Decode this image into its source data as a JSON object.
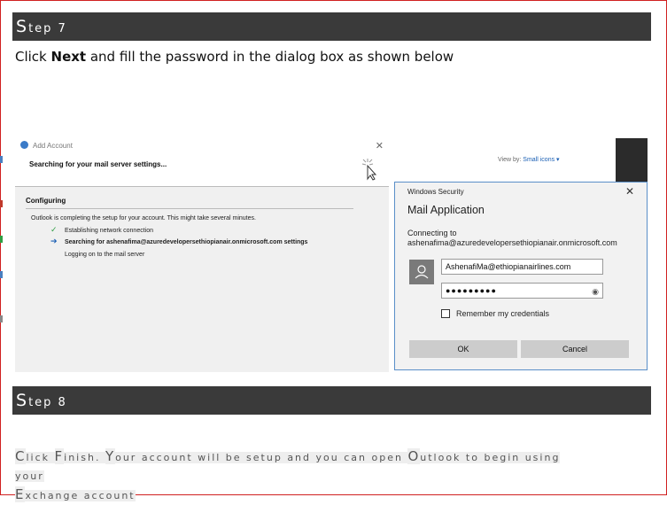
{
  "step7": {
    "first": "S",
    "rest": "tep 7"
  },
  "instruction": {
    "pre": "Click ",
    "bold": "Next",
    "post": " and fill the password in the dialog box as shown below"
  },
  "wizard": {
    "title": "Add Account",
    "subtitle": "Searching for your mail server settings...",
    "section": "Configuring",
    "description": "Outlook is completing the setup for your account. This might take several minutes.",
    "items": [
      {
        "mark": "✓",
        "text": "Establishing network connection",
        "bold": false
      },
      {
        "mark": "➔",
        "text": "Searching for ashenafima@azuredevelopersethiopianair.onmicrosoft.com settings",
        "bold": true
      },
      {
        "mark": "",
        "text": "Logging on to the mail server",
        "bold": false
      }
    ]
  },
  "view": {
    "label": "View by:",
    "value": "Small icons ▾"
  },
  "dialog": {
    "title": "Windows Security",
    "app": "Mail Application",
    "connecting_label": "Connecting to",
    "connecting_target": "ashenafima@azuredevelopersethiopianair.onmicrosoft.com",
    "username": "AshenafiMa@ethiopianairlines.com",
    "password": "●●●●●●●●●",
    "remember": "Remember my credentials",
    "ok": "OK",
    "cancel": "Cancel"
  },
  "step8": {
    "first": "S",
    "rest": "tep 8"
  },
  "final_text": {
    "c1": "C",
    "p1": "lick ",
    "c2": "F",
    "p2": "inish. ",
    "c3": "Y",
    "p3": "our account will be setup and you can open ",
    "c4": "O",
    "p4": "utlook to begin using your",
    "c5": "E",
    "p5": "xchange account"
  },
  "colors": {
    "step_bar": "#3a3a3a",
    "frame_border": "#d02020",
    "dialog_border": "#5a8fc8",
    "link": "#1a5fb4"
  }
}
